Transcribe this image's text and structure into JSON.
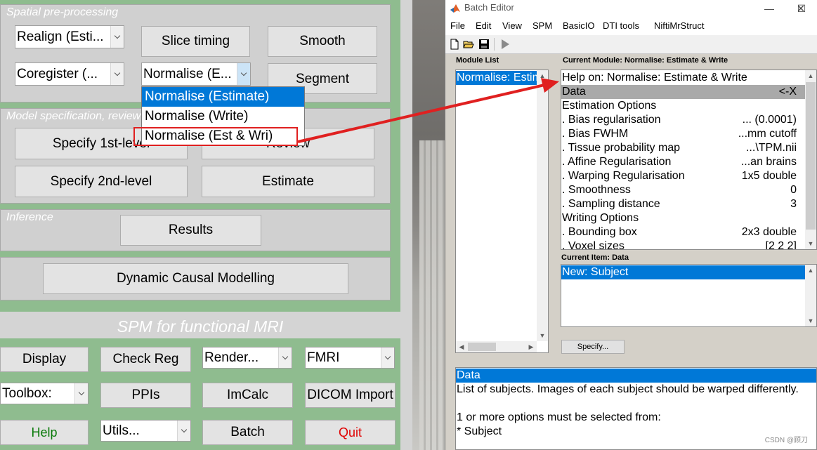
{
  "spm": {
    "panel1_title": "Spatial pre-processing",
    "realign": "Realign (Esti...",
    "slice_timing": "Slice timing",
    "smooth": "Smooth",
    "coregister": "Coregister (...",
    "normalise": "Normalise (E...",
    "segment": "Segment",
    "normalise_options": [
      "Normalise (Estimate)",
      "Normalise (Write)",
      "Normalise (Est & Wri)"
    ],
    "panel2_title": "Model specification, review",
    "specify_1st": "Specify 1st-level",
    "review": "Review",
    "specify_2nd": "Specify 2nd-level",
    "estimate": "Estimate",
    "panel3_title": "Inference",
    "results": "Results",
    "dcm": "Dynamic Causal Modelling",
    "footer_title": "SPM for functional MRI",
    "display": "Display",
    "check_reg": "Check Reg",
    "render": "Render...",
    "modality": "FMRI",
    "toolbox": "Toolbox:",
    "ppis": "PPIs",
    "imcalc": "ImCalc",
    "dicom": "DICOM Import",
    "help": "Help",
    "utils": "Utils...",
    "batch": "Batch",
    "quit": "Quit",
    "colors": {
      "panel_green": "#8fbc8f",
      "help_green": "#0a7a0a",
      "quit_red": "#e00000"
    }
  },
  "batch_editor": {
    "window_title": "Batch Editor",
    "window_buttons": [
      "—",
      "☐",
      "✕"
    ],
    "menu": [
      "File",
      "Edit",
      "View",
      "SPM",
      "BasicIO",
      "DTI tools",
      "NiftiMrStruct"
    ],
    "toolbar_icons": [
      "new-file-icon",
      "open-folder-icon",
      "save-icon",
      "run-icon"
    ],
    "module_list_label": "Module List",
    "module_list_item": "Normalise: Estim",
    "current_module_label": "Current Module: Normalise: Estimate & Write",
    "current_module_rows": [
      {
        "label": "Help on: Normalise: Estimate & Write",
        "value": ""
      },
      {
        "label": "Data",
        "value": "<-X"
      },
      {
        "label": "Estimation Options",
        "value": ""
      },
      {
        "label": ". Bias regularisation",
        "value": "... (0.0001)"
      },
      {
        "label": ". Bias FWHM",
        "value": "...mm cutoff"
      },
      {
        "label": ". Tissue probability map",
        "value": "...\\TPM.nii"
      },
      {
        "label": ". Affine Regularisation",
        "value": "...an brains"
      },
      {
        "label": ". Warping Regularisation",
        "value": "1x5 double"
      },
      {
        "label": ". Smoothness",
        "value": "0"
      },
      {
        "label": ". Sampling distance",
        "value": "3"
      },
      {
        "label": "Writing Options",
        "value": ""
      },
      {
        "label": ". Bounding box",
        "value": "2x3 double"
      },
      {
        "label": ". Voxel sizes",
        "value": "[2 2 2]"
      }
    ],
    "current_item_label": "Current Item: Data",
    "current_item_row": "New: Subject",
    "specify_button": "Specify...",
    "help_title": "Data",
    "help_lines": [
      "List of subjects. Images of each subject should be warped differently.",
      "",
      "1 or more options must be selected from:",
      "* Subject"
    ],
    "watermark": "CSDN @顾刀"
  }
}
